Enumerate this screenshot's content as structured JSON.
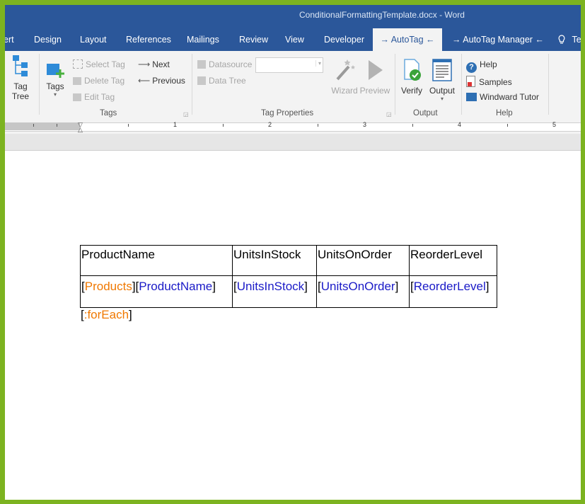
{
  "window": {
    "title": "ConditionalFormattingTemplate.docx  -  Word"
  },
  "tabs": [
    {
      "label": "ert"
    },
    {
      "label": "Design"
    },
    {
      "label": "Layout"
    },
    {
      "label": "References"
    },
    {
      "label": "Mailings"
    },
    {
      "label": "Review"
    },
    {
      "label": "View"
    },
    {
      "label": "Developer"
    },
    {
      "label": "→ AutoTag ←"
    },
    {
      "label": "→ AutoTag Manager ←"
    },
    {
      "label": "Te"
    }
  ],
  "ribbon": {
    "tag_tree": {
      "line1": "Tag",
      "line2": "Tree"
    },
    "tags": {
      "label": "Tags",
      "select_tag": "Select Tag",
      "delete_tag": "Delete Tag",
      "edit_tag": "Edit Tag",
      "next": "Next",
      "previous": "Previous",
      "group": "Tags"
    },
    "tag_properties": {
      "datasource": "Datasource",
      "data_tree": "Data Tree",
      "wizard": "Wizard",
      "preview": "Preview",
      "group": "Tag Properties"
    },
    "output": {
      "verify": "Verify",
      "output": "Output",
      "group": "Output"
    },
    "help": {
      "help": "Help",
      "samples": "Samples",
      "tutor": "Windward Tutor",
      "group": "Help"
    }
  },
  "ruler": {
    "numbers": [
      "1",
      "2",
      "3",
      "4",
      "5"
    ]
  },
  "document": {
    "headers": [
      "ProductName",
      "UnitsInStock",
      "UnitsOnOrder",
      "ReorderLevel"
    ],
    "row": {
      "products": "Products",
      "product_name": "ProductName",
      "units_in_stock": "UnitsInStock",
      "units_on_order": "UnitsOnOrder",
      "reorder_level": "ReorderLevel"
    },
    "foreach": ":forEach"
  },
  "colors": {
    "frame": "#7cb320",
    "titlebar": "#2b579a",
    "tag_orange": "#f07800",
    "tag_blue": "#1a1ac7"
  }
}
